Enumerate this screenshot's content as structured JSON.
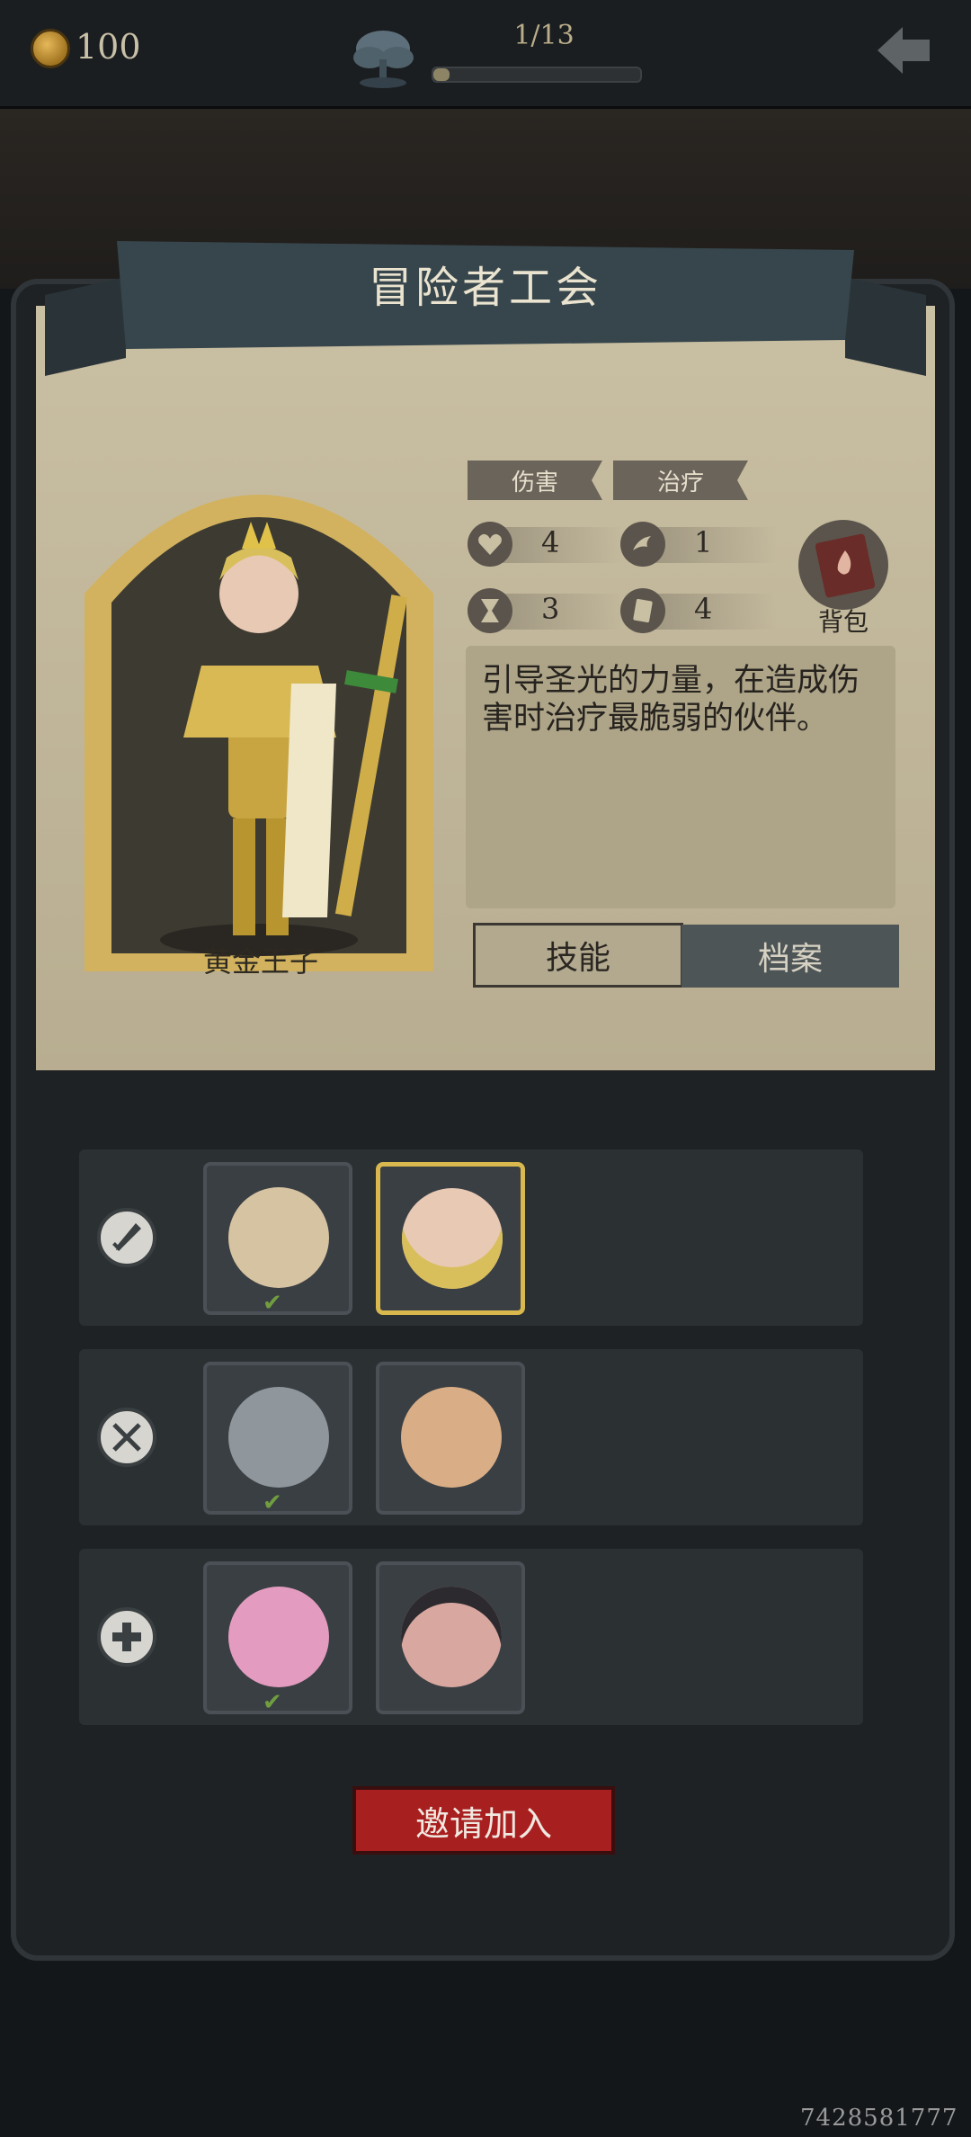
{
  "topbar": {
    "coins": "100",
    "progress_text": "1/13",
    "progress_fraction": 0.0769,
    "tree_icon": "tree-icon",
    "back_icon": "back-arrow-icon"
  },
  "panel": {
    "title": "冒险者工会"
  },
  "hero": {
    "name": "黄金王子",
    "tags": [
      "伤害",
      "治疗"
    ],
    "stats": [
      {
        "icon": "heart-icon",
        "value": "4"
      },
      {
        "icon": "bird-icon",
        "value": "1"
      },
      {
        "icon": "hourglass-icon",
        "value": "3"
      },
      {
        "icon": "card-icon",
        "value": "4"
      }
    ],
    "bag_label": "背包",
    "description": "引导圣光的力量，在造成伤害时治疗最脆弱的伙伴。",
    "tabs": {
      "skill": "技能",
      "archive": "档案"
    },
    "active_tab": "技能"
  },
  "team": {
    "rows": [
      {
        "role_icon": "sword-icon",
        "members": [
          "mouse-girl-portrait",
          "golden-prince-portrait"
        ],
        "selected": 1
      },
      {
        "role_icon": "crossed-weapons-icon",
        "members": [
          "robot-portrait",
          "boy-green-hat-portrait"
        ],
        "selected": -1
      },
      {
        "role_icon": "plus-icon",
        "members": [
          "pink-hair-elf-portrait",
          "bow-girl-portrait"
        ],
        "selected": -1
      }
    ]
  },
  "actions": {
    "invite_label": "邀请加入"
  },
  "footer": {
    "id_text": "7428581777"
  },
  "colors": {
    "parchment": "#c9bfa3",
    "panel": "#1e2224",
    "accent_gold": "#d9b84e",
    "invite_red": "#a81f1f"
  }
}
